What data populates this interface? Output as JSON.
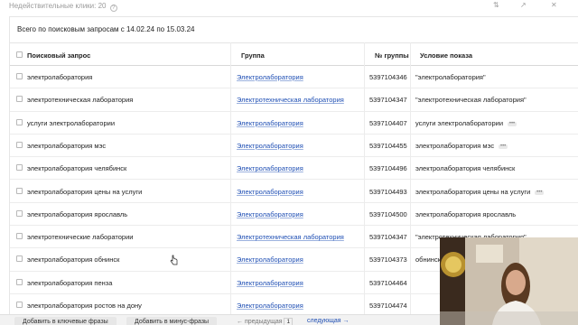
{
  "top_note": "Недействительные клики: 20",
  "period": "Всего по поисковым запросам с 14.02.24 по 15.03.24",
  "columns": {
    "query": "Поисковый запрос",
    "group": "Группа",
    "group_no": "№ группы",
    "condition": "Условие показа"
  },
  "rows": [
    {
      "query": "электролаборатория",
      "group": "Электролаборатория",
      "group_no": "5397104346",
      "condition": "\"электролаборатория\"",
      "more": false
    },
    {
      "query": "электротехническая лаборатория",
      "group": "Электротехническая лаборатория",
      "group_no": "5397104347",
      "condition": "\"электротехническая лаборатория\"",
      "more": false
    },
    {
      "query": "услуги электролаборатории",
      "group": "Электролаборатория",
      "group_no": "5397104407",
      "condition": "услуги электролаборатории",
      "more": true
    },
    {
      "query": "электролаборатория мэс",
      "group": "Электролаборатория",
      "group_no": "5397104455",
      "condition": "электролаборатория мэс",
      "more": true
    },
    {
      "query": "электролаборатория челябинск",
      "group": "Электролаборатория",
      "group_no": "5397104496",
      "condition": "электролаборатория челябинск",
      "more": false
    },
    {
      "query": "электролаборатория цены на услуги",
      "group": "Электролаборатория",
      "group_no": "5397104493",
      "condition": "электролаборатория цены на услуги",
      "more": true
    },
    {
      "query": "электролаборатория ярославль",
      "group": "Электролаборатория",
      "group_no": "5397104500",
      "condition": "электролаборатория ярославль",
      "more": false
    },
    {
      "query": "электротехнические лаборатории",
      "group": "Электротехническая лаборатория",
      "group_no": "5397104347",
      "condition": "\"электротехническая лаборатория\"",
      "more": false
    },
    {
      "query": "электролаборатория обнинск",
      "group": "Электролаборатория",
      "group_no": "5397104373",
      "condition": "обнинск",
      "more": false
    },
    {
      "query": "электролаборатория пенза",
      "group": "Электролаборатория",
      "group_no": "5397104464",
      "condition": "",
      "more": false
    },
    {
      "query": "электролаборатория ростов на дону",
      "group": "Электролаборатория",
      "group_no": "5397104474",
      "condition": "",
      "more": false
    }
  ],
  "bottom": {
    "add_keywords": "Добавить в ключевые фразы",
    "add_minus": "Добавить в минус-фразы",
    "prev": "← предыдущая",
    "page": "1",
    "next": "следующая →"
  },
  "icons": [
    "info-icon",
    "collapse-icon",
    "expand-icon",
    "close-icon",
    "checkbox",
    "more-icon",
    "mouse-cursor-icon"
  ],
  "colors": {
    "link": "#1f4fb4",
    "header_border": "#d8d8d8",
    "bottom_bar": "#f2f2f2"
  }
}
